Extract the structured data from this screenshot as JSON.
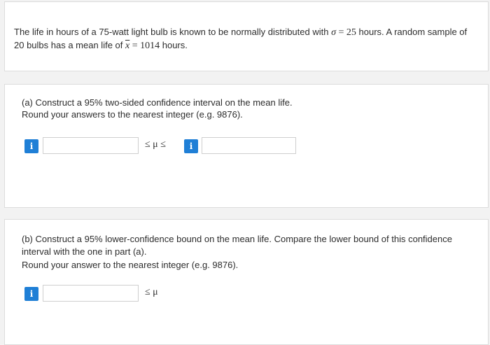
{
  "problem": {
    "line1_pre": "The life in hours of a 75-watt light bulb is known to be normally distributed with ",
    "sigma_symbol": "σ",
    "equals": " = ",
    "sigma_value": "25",
    "line1_post": " hours. A random sample of",
    "line2_pre": "20 bulbs has a mean life of ",
    "xbar_symbol": "x",
    "mean_value": "1014",
    "line2_post": " hours."
  },
  "part_a": {
    "line1": "(a) Construct a 95% two-sided confidence interval on the mean life.",
    "line2": "Round your answers to the nearest integer (e.g. 9876).",
    "info_label": "i",
    "lower_value": "",
    "upper_value": "",
    "relation": "≤ μ ≤"
  },
  "part_b": {
    "line1": "(b) Construct a 95% lower-confidence bound on the mean life. Compare the lower bound of this confidence",
    "line2": "interval with the one in part (a).",
    "line3": "Round your answer to the nearest integer (e.g. 9876).",
    "info_label": "i",
    "bound_value": "",
    "relation": "≤ μ"
  },
  "colors": {
    "info_button": "#1f7fd6",
    "card_border": "#dcdcdc",
    "page_background": "#f2f2f2"
  }
}
